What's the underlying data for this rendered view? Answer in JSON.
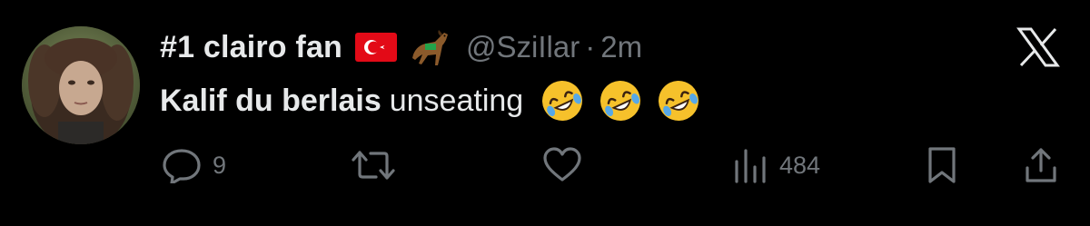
{
  "tweet": {
    "display_name": "#1 clairo fan",
    "flag_icon": "turkey-flag-emoji",
    "horse_icon": "horse-racing-emoji",
    "handle": "@SziIlar",
    "separator": "·",
    "timestamp": "2m",
    "text_mention": "Kalif du berlais",
    "text_rest": "unseating",
    "emojis": [
      "rolling-on-floor-laughing-emoji",
      "rolling-on-floor-laughing-emoji",
      "rolling-on-floor-laughing-emoji"
    ],
    "platform_icon": "x-logo-icon"
  },
  "actions": {
    "reply_count": "9",
    "retweet_count": "",
    "like_count": "",
    "views_count": "484"
  },
  "colors": {
    "background": "#000000",
    "text_primary": "#e7e9ea",
    "text_secondary": "#71767b",
    "flag_red": "#e30a17",
    "emoji_yellow": "#f6c12b"
  }
}
